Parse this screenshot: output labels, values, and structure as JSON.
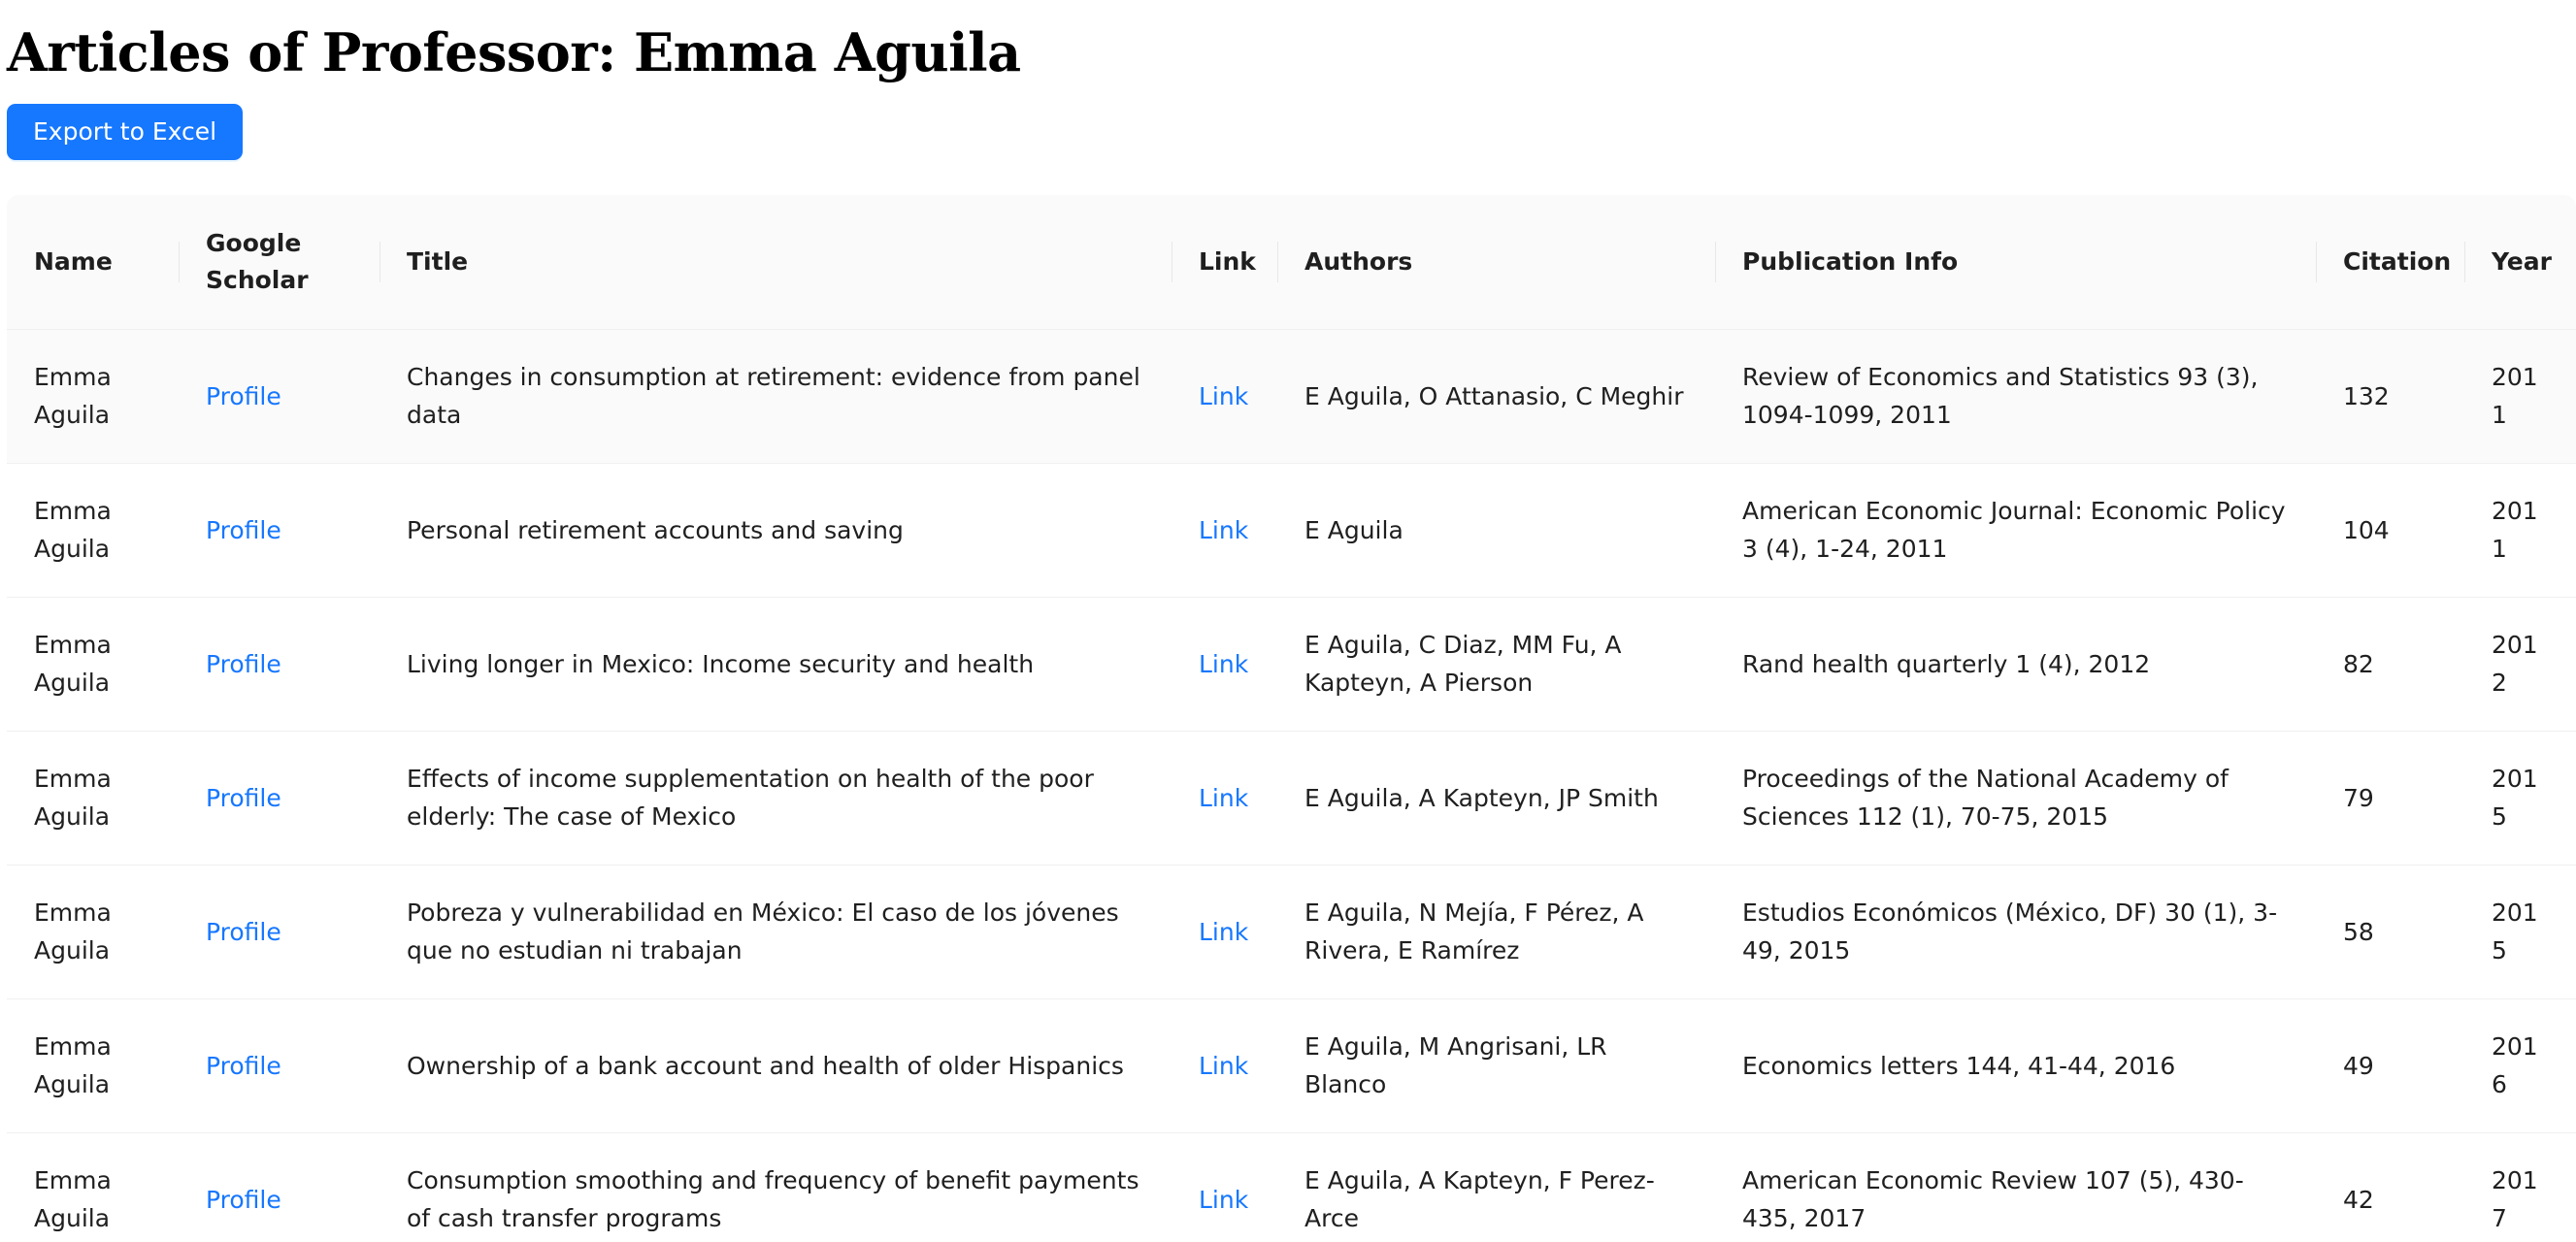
{
  "page": {
    "title": "Articles of Professor: Emma Aguila",
    "export_label": "Export to Excel"
  },
  "table": {
    "columns": [
      {
        "key": "name",
        "label": "Name"
      },
      {
        "key": "scholar",
        "label": "Google Scholar"
      },
      {
        "key": "title",
        "label": "Title"
      },
      {
        "key": "link",
        "label": "Link"
      },
      {
        "key": "authors",
        "label": "Authors"
      },
      {
        "key": "pubinfo",
        "label": "Publication Info"
      },
      {
        "key": "citation",
        "label": "Citation"
      },
      {
        "key": "year",
        "label": "Year"
      }
    ],
    "rows": [
      {
        "name": "Emma Aguila",
        "scholar": "Profile",
        "title": "Changes in consumption at retirement: evidence from panel data",
        "link": "Link",
        "authors": "E Aguila, O Attanasio, C Meghir",
        "pubinfo": "Review of Economics and Statistics 93 (3), 1094-1099, 2011",
        "citation": "132",
        "year": "2011"
      },
      {
        "name": "Emma Aguila",
        "scholar": "Profile",
        "title": "Personal retirement accounts and saving",
        "link": "Link",
        "authors": "E Aguila",
        "pubinfo": "American Economic Journal: Economic Policy 3 (4), 1-24, 2011",
        "citation": "104",
        "year": "2011"
      },
      {
        "name": "Emma Aguila",
        "scholar": "Profile",
        "title": "Living longer in Mexico: Income security and health",
        "link": "Link",
        "authors": "E Aguila, C Diaz, MM Fu, A Kapteyn, A Pierson",
        "pubinfo": "Rand health quarterly 1 (4), 2012",
        "citation": "82",
        "year": "2012"
      },
      {
        "name": "Emma Aguila",
        "scholar": "Profile",
        "title": "Effects of income supplementation on health of the poor elderly: The case of Mexico",
        "link": "Link",
        "authors": "E Aguila, A Kapteyn, JP Smith",
        "pubinfo": "Proceedings of the National Academy of Sciences 112 (1), 70-75, 2015",
        "citation": "79",
        "year": "2015"
      },
      {
        "name": "Emma Aguila",
        "scholar": "Profile",
        "title": "Pobreza y vulnerabilidad en México: El caso de los jóvenes que no estudian ni trabajan",
        "link": "Link",
        "authors": "E Aguila, N Mejía, F Pérez, A Rivera, E Ramírez",
        "pubinfo": "Estudios Económicos (México, DF) 30 (1), 3-49, 2015",
        "citation": "58",
        "year": "2015"
      },
      {
        "name": "Emma Aguila",
        "scholar": "Profile",
        "title": "Ownership of a bank account and health of older Hispanics",
        "link": "Link",
        "authors": "E Aguila, M Angrisani, LR Blanco",
        "pubinfo": "Economics letters 144, 41-44, 2016",
        "citation": "49",
        "year": "2016"
      },
      {
        "name": "Emma Aguila",
        "scholar": "Profile",
        "title": "Consumption smoothing and frequency of benefit payments of cash transfer programs",
        "link": "Link",
        "authors": "E Aguila, A Kapteyn, F Perez-Arce",
        "pubinfo": "American Economic Review 107 (5), 430-435, 2017",
        "citation": "42",
        "year": "2017"
      }
    ]
  }
}
